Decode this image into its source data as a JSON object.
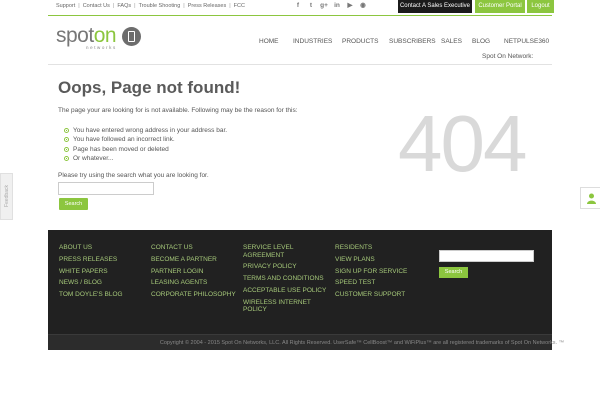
{
  "top_links": [
    "Support",
    "Contact Us",
    "FAQs",
    "Trouble Shooting",
    "Press Releases",
    "FCC"
  ],
  "socials": [
    {
      "name": "facebook-icon",
      "glyph": "f"
    },
    {
      "name": "twitter-icon",
      "glyph": "t"
    },
    {
      "name": "google-plus-icon",
      "glyph": "g+"
    },
    {
      "name": "linkedin-icon",
      "glyph": "in"
    },
    {
      "name": "youtube-icon",
      "glyph": "▶"
    },
    {
      "name": "rss-icon",
      "glyph": "◉"
    }
  ],
  "top_buttons": {
    "contact": "Contact A Sales Executive",
    "portal": "Customer Portal",
    "logout": "Logout"
  },
  "logo": {
    "text_a": "spot",
    "text_b": "on",
    "sub": "networks"
  },
  "nav": {
    "home": "HOME",
    "industries": "INDUSTRIES",
    "products": "PRODUCTS",
    "subscribers": "SUBSCRIBERS",
    "sales": "SALES",
    "blog": "BLOG",
    "netpulse": "NETPULSE360"
  },
  "sub_caption": "Spot On Network:",
  "content": {
    "title": "Oops, Page not found!",
    "intro": "The page your are looking for is not available. Following may be the reason for this:",
    "reasons": [
      "You have entered wrong address in your address bar.",
      "You have followed an incorrect link.",
      "Page has been moved or deleted",
      "Or whatever..."
    ],
    "big_code": "404",
    "try_text": "Please try using the search what you are looking for.",
    "search_value": "",
    "search_button": "Search"
  },
  "side": {
    "feedback": "Feedback"
  },
  "footer": {
    "col1": [
      "ABOUT US",
      "PRESS RELEASES",
      "WHITE PAPERS",
      "NEWS / BLOG",
      "TOM DOYLE'S BLOG"
    ],
    "col2": [
      "CONTACT US",
      "BECOME A PARTNER",
      "PARTNER LOGIN",
      "LEASING AGENTS",
      "CORPORATE PHILOSOPHY"
    ],
    "col3": [
      "SERVICE LEVEL AGREEMENT",
      "PRIVACY POLICY",
      "TERMS AND CONDITIONS",
      "ACCEPTABLE USE POLICY",
      "WIRELESS INTERNET POLICY"
    ],
    "col4": [
      "RESIDENTS",
      "VIEW PLANS",
      "SIGN UP FOR SERVICE",
      "SPEED TEST",
      "CUSTOMER SUPPORT"
    ],
    "search_value": "",
    "search_button": "Search",
    "copyright": "Copyright © 2004 - 2015 Spot On Networks, LLC. All Rights Reserved. UserSafe™ CellBoost™ and WiFiPlus™ are all registered trademarks of Spot On Networks. ™"
  },
  "colors": {
    "accent": "#8cc63f",
    "footer_bg": "#212121",
    "footer_link": "#a6c97a",
    "code_gray": "#d9d9d9"
  }
}
